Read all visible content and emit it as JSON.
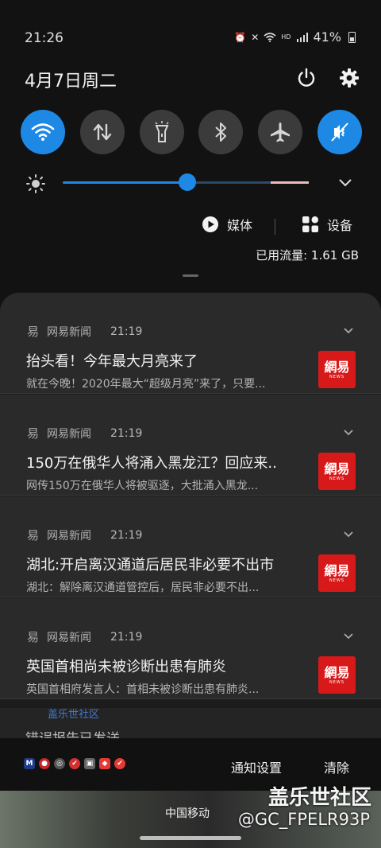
{
  "status": {
    "time": "21:26",
    "battery_pct": "41%",
    "icons": [
      "alarm-icon",
      "vibrate-off-icon",
      "wifi-icon",
      "hd-icon",
      "4g-signal-icon",
      "battery-icon"
    ]
  },
  "header": {
    "date": "4月7日周二",
    "buttons": [
      "power-icon",
      "settings-icon"
    ]
  },
  "quick_settings": [
    {
      "name": "wifi",
      "icon": "wifi-icon",
      "on": true
    },
    {
      "name": "mobile-data",
      "icon": "data-arrows-icon",
      "on": false
    },
    {
      "name": "flashlight",
      "icon": "flashlight-icon",
      "on": false
    },
    {
      "name": "bluetooth",
      "icon": "bluetooth-icon",
      "on": false
    },
    {
      "name": "airplane",
      "icon": "airplane-icon",
      "on": false
    },
    {
      "name": "sound",
      "icon": "mute-icon",
      "on": true
    }
  ],
  "brightness": {
    "level": 0.5
  },
  "media": {
    "media_label": "媒体",
    "device_label": "设备"
  },
  "usage": {
    "text": "已用流量: 1.61 GB"
  },
  "notifications": [
    {
      "app": "网易新闻",
      "time": "21:19",
      "title": "抬头看！今年最大月亮来了",
      "body": "就在今晚！2020年最大“超级月亮”来了，只要..."
    },
    {
      "app": "网易新闻",
      "time": "21:19",
      "title": "150万在俄华人将涌入黑龙江？回应来..",
      "body": "网传150万在俄华人将被驱逐，大批涌入黑龙..."
    },
    {
      "app": "网易新闻",
      "time": "21:19",
      "title": "湖北:开启离汉通道后居民非必要不出市",
      "body": "湖北：解除离汉通道管控后，居民非必要不出..."
    },
    {
      "app": "网易新闻",
      "time": "21:19",
      "title": "英国首相尚未被诊断出患有肺炎",
      "body": "英国首相府发言人：首相未被诊断出患有肺炎..."
    }
  ],
  "thumb": {
    "big": "網易",
    "small": "NEWS"
  },
  "peek": {
    "source": "盖乐世社区",
    "message": "错误报告已发送"
  },
  "bottom": {
    "settings_label": "通知设置",
    "clear_label": "清除"
  },
  "home": {
    "carrier": "中国移动"
  },
  "watermark": {
    "line1": "盖乐世社区",
    "line2": "@GC_FPELR93P"
  }
}
